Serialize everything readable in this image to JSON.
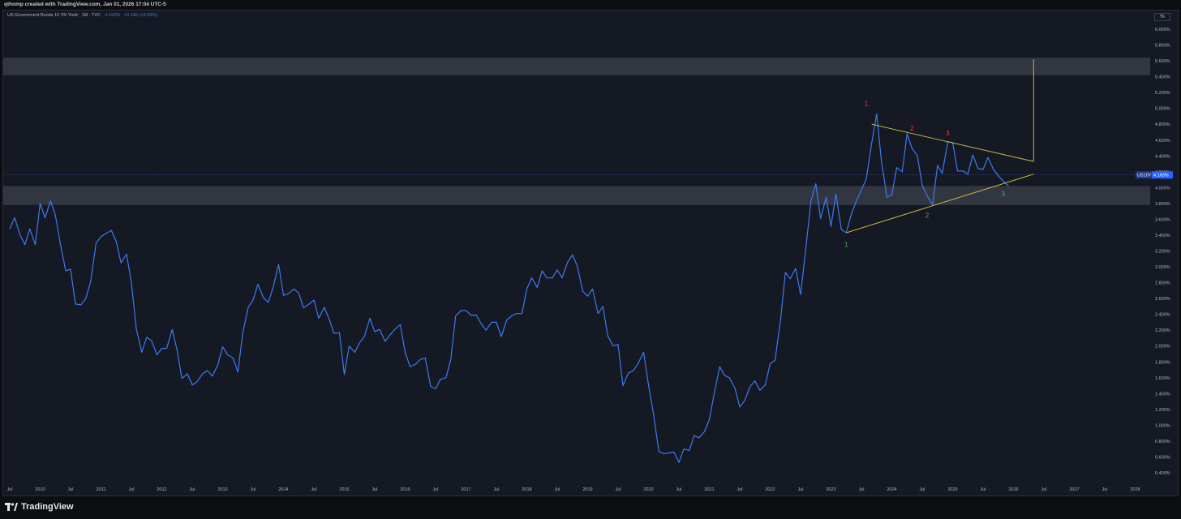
{
  "header": {
    "caption": "qthomp created with TradingView.com, Jan 01, 2026 17:04 UTC-5"
  },
  "legend": {
    "symbol": "US Government Bonds 10 YR Yield · 1M · TVC",
    "value": "4.163%",
    "change": "+0.146 (+3.63%)"
  },
  "unit_label": "%",
  "price_label": {
    "ticker": "US10Y",
    "value": "4.163%"
  },
  "footer": {
    "brand": "TradingView"
  },
  "colors": {
    "line": "#3d79f2",
    "trend": "#d4c548",
    "zone": "#4a4f5a",
    "red": "#f23645",
    "green": "#4caf50"
  },
  "chart_data": {
    "type": "line",
    "title": "US Government Bonds 10 YR Yield · 1M · TVC",
    "y_ticks": [
      "6.000%",
      "5.800%",
      "5.600%",
      "5.400%",
      "5.200%",
      "5.000%",
      "4.800%",
      "4.600%",
      "4.400%",
      "4.200%",
      "4.000%",
      "3.800%",
      "3.600%",
      "3.400%",
      "3.200%",
      "3.000%",
      "2.800%",
      "2.600%",
      "2.400%",
      "2.200%",
      "2.000%",
      "1.800%",
      "1.600%",
      "1.400%",
      "1.200%",
      "1.000%",
      "0.800%",
      "0.600%",
      "0.400%"
    ],
    "x_ticks": [
      "Jul",
      "2010",
      "Jul",
      "2011",
      "Jul",
      "2012",
      "Jul",
      "2013",
      "Jul",
      "2014",
      "Jul",
      "2015",
      "Jul",
      "2016",
      "Jul",
      "2017",
      "Jul",
      "2018",
      "Jul",
      "2019",
      "Jul",
      "2020",
      "Jul",
      "2021",
      "Jul",
      "2022",
      "Jul",
      "2023",
      "Jul",
      "2024",
      "Jul",
      "2025",
      "Jul",
      "2026",
      "Jul",
      "2027",
      "Jul",
      "2028"
    ],
    "ylim": [
      0.3,
      6.1
    ],
    "x_range": [
      2009.5,
      2028.5
    ],
    "x": [
      2009.5,
      2009.58,
      2009.67,
      2009.75,
      2009.83,
      2009.92,
      2010.0,
      2010.08,
      2010.17,
      2010.25,
      2010.33,
      2010.42,
      2010.5,
      2010.58,
      2010.67,
      2010.75,
      2010.83,
      2010.92,
      2011.0,
      2011.08,
      2011.17,
      2011.25,
      2011.33,
      2011.42,
      2011.5,
      2011.58,
      2011.67,
      2011.75,
      2011.83,
      2011.92,
      2012.0,
      2012.08,
      2012.17,
      2012.25,
      2012.33,
      2012.42,
      2012.5,
      2012.58,
      2012.67,
      2012.75,
      2012.83,
      2012.92,
      2013.0,
      2013.08,
      2013.17,
      2013.25,
      2013.33,
      2013.42,
      2013.5,
      2013.58,
      2013.67,
      2013.75,
      2013.83,
      2013.92,
      2014.0,
      2014.08,
      2014.17,
      2014.25,
      2014.33,
      2014.42,
      2014.5,
      2014.58,
      2014.67,
      2014.75,
      2014.83,
      2014.92,
      2015.0,
      2015.08,
      2015.17,
      2015.25,
      2015.33,
      2015.42,
      2015.5,
      2015.58,
      2015.67,
      2015.75,
      2015.83,
      2015.92,
      2016.0,
      2016.08,
      2016.17,
      2016.25,
      2016.33,
      2016.42,
      2016.5,
      2016.58,
      2016.67,
      2016.75,
      2016.83,
      2016.92,
      2017.0,
      2017.08,
      2017.17,
      2017.25,
      2017.33,
      2017.42,
      2017.5,
      2017.58,
      2017.67,
      2017.75,
      2017.83,
      2017.92,
      2018.0,
      2018.08,
      2018.17,
      2018.25,
      2018.33,
      2018.42,
      2018.5,
      2018.58,
      2018.67,
      2018.75,
      2018.83,
      2018.92,
      2019.0,
      2019.08,
      2019.17,
      2019.25,
      2019.33,
      2019.42,
      2019.5,
      2019.58,
      2019.67,
      2019.75,
      2019.83,
      2019.92,
      2020.0,
      2020.08,
      2020.17,
      2020.25,
      2020.33,
      2020.42,
      2020.5,
      2020.58,
      2020.67,
      2020.75,
      2020.83,
      2020.92,
      2021.0,
      2021.08,
      2021.17,
      2021.25,
      2021.33,
      2021.42,
      2021.5,
      2021.58,
      2021.67,
      2021.75,
      2021.83,
      2021.92,
      2022.0,
      2022.08,
      2022.17,
      2022.25,
      2022.33,
      2022.42,
      2022.5,
      2022.58,
      2022.67,
      2022.75,
      2022.83,
      2022.92,
      2023.0,
      2023.08,
      2023.17,
      2023.25,
      2023.33,
      2023.42,
      2023.5,
      2023.58,
      2023.67,
      2023.75,
      2023.83,
      2023.92,
      2024.0,
      2024.08,
      2024.17,
      2024.25,
      2024.33,
      2024.42,
      2024.5,
      2024.58,
      2024.67,
      2024.75,
      2024.83,
      2024.92,
      2025.0,
      2025.08,
      2025.17,
      2025.25,
      2025.33,
      2025.42,
      2025.5,
      2025.58,
      2025.67,
      2025.75,
      2025.83,
      2025.92
    ],
    "y": [
      3.48,
      3.62,
      3.4,
      3.28,
      3.48,
      3.28,
      3.8,
      3.62,
      3.83,
      3.65,
      3.3,
      2.95,
      2.97,
      2.53,
      2.52,
      2.6,
      2.81,
      3.3,
      3.38,
      3.42,
      3.46,
      3.32,
      3.05,
      3.16,
      2.8,
      2.22,
      1.92,
      2.11,
      2.07,
      1.89,
      1.97,
      1.97,
      2.21,
      1.95,
      1.59,
      1.65,
      1.51,
      1.55,
      1.65,
      1.69,
      1.62,
      1.76,
      1.99,
      1.89,
      1.85,
      1.67,
      2.16,
      2.49,
      2.58,
      2.78,
      2.61,
      2.55,
      2.74,
      3.03,
      2.64,
      2.66,
      2.72,
      2.67,
      2.48,
      2.53,
      2.58,
      2.35,
      2.49,
      2.34,
      2.16,
      2.17,
      1.64,
      2.0,
      1.92,
      2.04,
      2.12,
      2.35,
      2.18,
      2.21,
      2.06,
      2.14,
      2.21,
      2.27,
      1.92,
      1.74,
      1.77,
      1.83,
      1.85,
      1.49,
      1.46,
      1.58,
      1.6,
      1.83,
      2.38,
      2.45,
      2.45,
      2.39,
      2.39,
      2.28,
      2.2,
      2.3,
      2.3,
      2.12,
      2.33,
      2.38,
      2.41,
      2.41,
      2.72,
      2.86,
      2.74,
      2.95,
      2.86,
      2.86,
      2.96,
      2.86,
      3.06,
      3.15,
      3.01,
      2.69,
      2.63,
      2.72,
      2.41,
      2.5,
      2.13,
      2.0,
      2.02,
      1.5,
      1.66,
      1.69,
      1.78,
      1.92,
      1.51,
      1.15,
      0.67,
      0.64,
      0.65,
      0.66,
      0.53,
      0.7,
      0.68,
      0.87,
      0.84,
      0.92,
      1.07,
      1.4,
      1.74,
      1.63,
      1.6,
      1.47,
      1.23,
      1.31,
      1.49,
      1.56,
      1.44,
      1.51,
      1.78,
      1.82,
      2.33,
      2.93,
      2.85,
      2.98,
      2.65,
      3.19,
      3.83,
      4.05,
      3.61,
      3.88,
      3.51,
      3.92,
      3.47,
      3.43,
      3.65,
      3.84,
      3.97,
      4.11,
      4.57,
      4.93,
      4.33,
      3.88,
      3.91,
      4.25,
      4.2,
      4.68,
      4.5,
      4.4,
      4.03,
      3.9,
      3.78,
      4.28,
      4.18,
      4.58,
      4.57,
      4.21,
      4.21,
      4.17,
      4.41,
      4.24,
      4.23,
      4.38,
      4.23,
      4.15,
      4.08,
      4.02,
      4.16
    ]
  },
  "annotations": {
    "peaks": [
      "1",
      "2",
      "3"
    ],
    "troughs": [
      "1",
      "2",
      "3"
    ]
  }
}
